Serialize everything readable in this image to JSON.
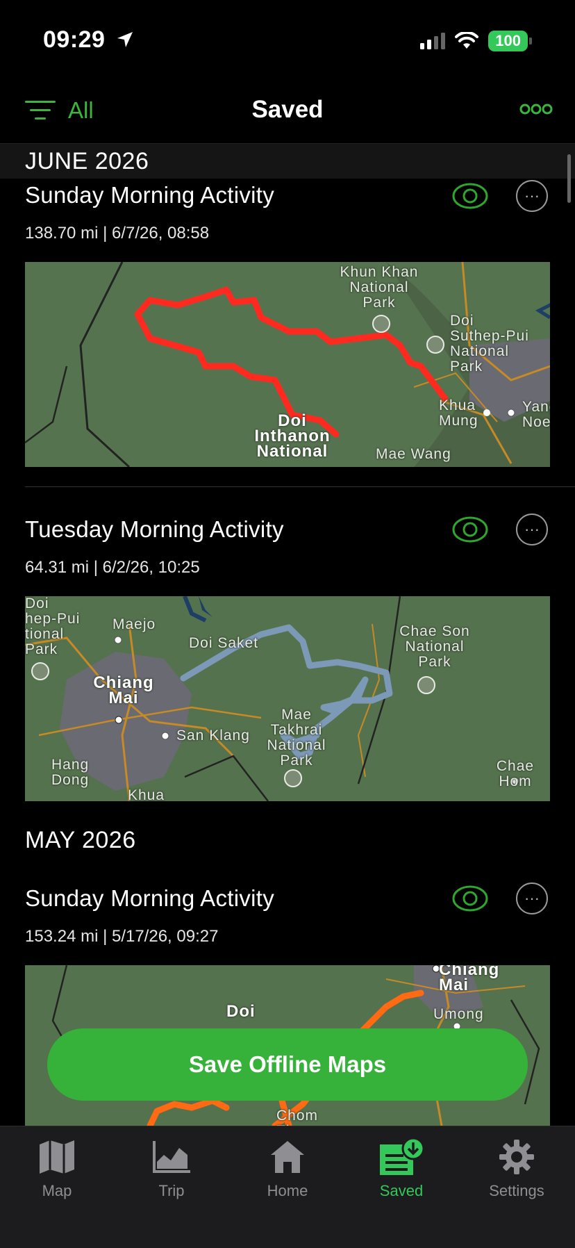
{
  "status_bar": {
    "time": "09:29",
    "battery": "100"
  },
  "header": {
    "filter_label": "All",
    "title": "Saved"
  },
  "sticky_month": "JUNE 2026",
  "activities": [
    {
      "title": "Sunday Morning Activity",
      "meta": "138.70 mi | 6/7/26, 08:58",
      "track_color": "#ff2a1f",
      "map_labels": [
        "Khun Khan\nNational\nPark",
        "Doi\nSuthep-Pui\nNational\nPark",
        "Khua\nMung",
        "Yang\nNoen",
        "Doi\nInthanon\nNational",
        "Mae Wang"
      ]
    },
    {
      "title": "Tuesday Morning Activity",
      "meta": "64.31 mi | 6/2/26, 10:25",
      "track_color": "#7d99b8",
      "map_labels": [
        "Doi\nhep-Pui\ntional\nPark",
        "Maejo",
        "Doi Saket",
        "Chae Son\nNational\nPark",
        "Chiang\nMai",
        "San Klang",
        "Mae\nTakhrai\nNational\nPark",
        "Hang\nDong",
        "Khua",
        "Chae Hom"
      ]
    },
    {
      "title": "Sunday Morning Activity",
      "meta": "153.24 mi | 5/17/26, 09:27",
      "track_color": "#ff6a13",
      "map_labels": [
        "Chiang\nMai",
        "Umong",
        "Doi",
        "Chom\nThong"
      ]
    }
  ],
  "month_may": "MAY 2026",
  "cta_label": "Save Offline Maps",
  "tabs": [
    {
      "label": "Map",
      "icon": "map-icon"
    },
    {
      "label": "Trip",
      "icon": "chart-icon"
    },
    {
      "label": "Home",
      "icon": "home-icon"
    },
    {
      "label": "Saved",
      "icon": "saved-download-icon",
      "active": true
    },
    {
      "label": "Settings",
      "icon": "gear-icon"
    }
  ],
  "colors": {
    "accent": "#34c759",
    "background": "#000000",
    "tab_inactive": "#8e8e93"
  }
}
